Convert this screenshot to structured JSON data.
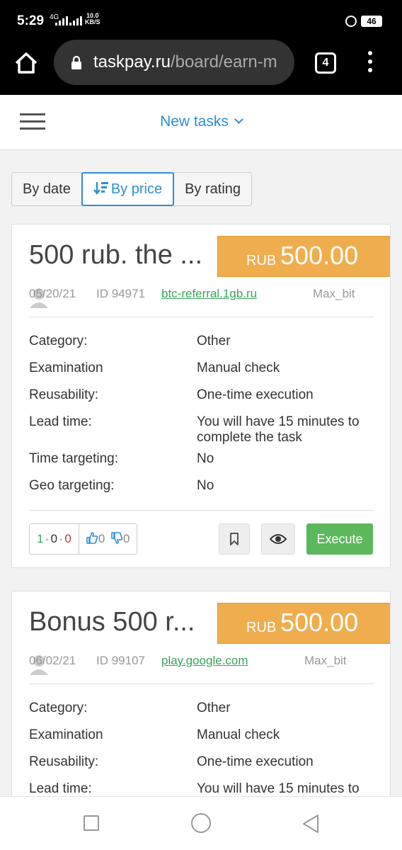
{
  "status_bar": {
    "time": "5:29",
    "network": "4G",
    "speed_value": "10.0",
    "speed_unit": "KB/S",
    "battery": "46"
  },
  "browser": {
    "url_domain": "taskpay.ru",
    "url_path": "/board/earn-m",
    "tab_count": "4"
  },
  "header": {
    "nav_title": "New tasks"
  },
  "sort": {
    "by_date": "By date",
    "by_price": "By price",
    "by_rating": "By rating",
    "active": "by_price"
  },
  "labels": {
    "category": "Category:",
    "examination": "Examination",
    "reusability": "Reusability:",
    "lead_time": "Lead time:",
    "time_targeting": "Time targeting:",
    "geo_targeting": "Geo targeting:",
    "execute": "Execute"
  },
  "tasks": [
    {
      "title": "500 rub. the ...",
      "currency": "RUB",
      "price": "500.00",
      "date": "05/20/21",
      "id": "ID 94971",
      "domain": "btc-referral.1gb.ru",
      "author": "Max_bit",
      "category": "Other",
      "examination": "Manual check",
      "reusability": "One-time execution",
      "lead_time": "You will have 15 minutes to complete the task",
      "time_targeting": "No",
      "geo_targeting": "No",
      "stat_green": "1",
      "stat_black": "0",
      "stat_red": "0",
      "likes": "0",
      "dislikes": "0"
    },
    {
      "title": "Bonus 500 r...",
      "currency": "RUB",
      "price": "500.00",
      "date": "06/02/21",
      "id": "ID 99107",
      "domain": "play.google.com",
      "author": "Max_bit",
      "category": "Other",
      "examination": "Manual check",
      "reusability": "One-time execution",
      "lead_time": "You will have 15 minutes to"
    }
  ],
  "colors": {
    "accent": "#2b8fd6",
    "price_badge": "#f0ad4e",
    "execute": "#5cb85c",
    "link": "#3aa55b"
  }
}
